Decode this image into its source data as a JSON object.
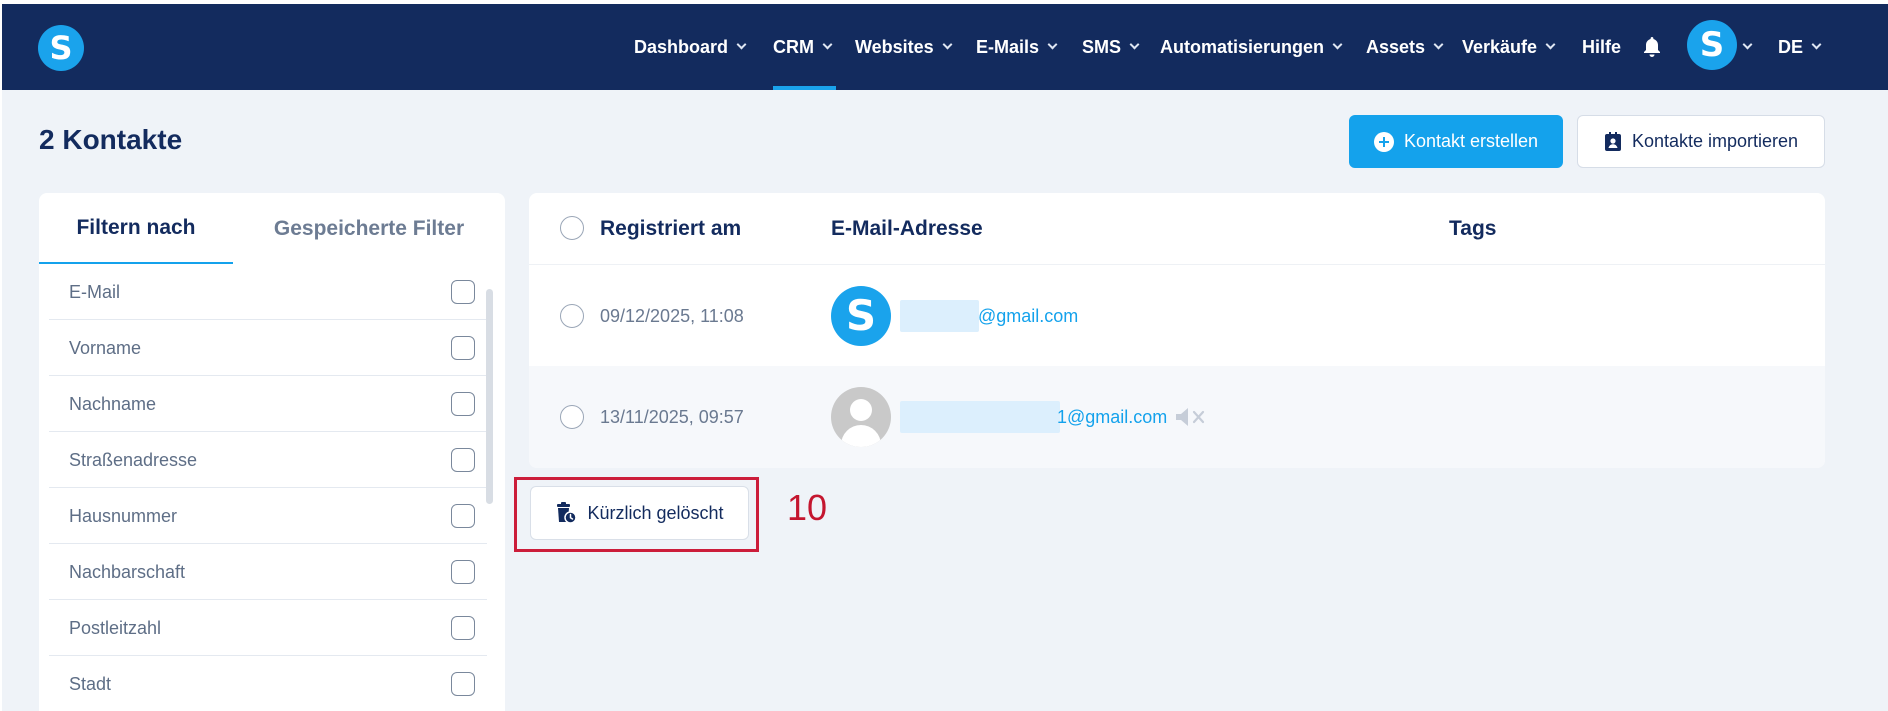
{
  "app": {
    "logo_letter": "S",
    "brand_color": "#1aa3ec",
    "nav_bg": "#132b5e"
  },
  "nav": {
    "items": [
      {
        "label": "Dashboard",
        "has_dropdown": true
      },
      {
        "label": "CRM",
        "has_dropdown": true,
        "active": true
      },
      {
        "label": "Websites",
        "has_dropdown": true
      },
      {
        "label": "E-Mails",
        "has_dropdown": true
      },
      {
        "label": "SMS",
        "has_dropdown": true
      },
      {
        "label": "Automatisierungen",
        "has_dropdown": true
      },
      {
        "label": "Assets",
        "has_dropdown": true
      },
      {
        "label": "Verkäufe",
        "has_dropdown": true
      },
      {
        "label": "Hilfe",
        "has_dropdown": false
      }
    ],
    "notification_icon": "bell-icon",
    "avatar_letter": "S",
    "language": "DE"
  },
  "header": {
    "title": "2 Kontakte",
    "create_button": "Kontakt erstellen",
    "import_button": "Kontakte importieren"
  },
  "filters": {
    "tabs": [
      "Filtern nach",
      "Gespeicherte Filter"
    ],
    "active_tab": "Filtern nach",
    "fields": [
      "E-Mail",
      "Vorname",
      "Nachname",
      "Straßenadresse",
      "Hausnummer",
      "Nachbarschaft",
      "Postleitzahl",
      "Stadt"
    ]
  },
  "table": {
    "columns": [
      "Registriert am",
      "E-Mail-Adresse",
      "Tags"
    ],
    "rows": [
      {
        "registered": "09/12/2025, 11:08",
        "avatar": "S",
        "email_visible": "@gmail.com"
      },
      {
        "registered": "13/11/2025, 09:57",
        "avatar": "default-user",
        "email_visible": "1@gmail.com",
        "muted_icon": "mute-icon"
      }
    ]
  },
  "recently_deleted_button": "Kürzlich gelöscht",
  "annotation": {
    "number": "10",
    "color": "#cc1d3a"
  }
}
